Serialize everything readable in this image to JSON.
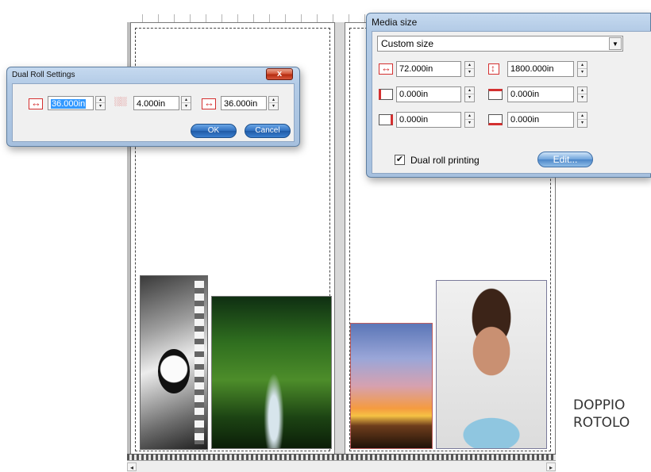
{
  "dual_roll_dialog": {
    "title": "Dual Roll Settings",
    "close_label": "x",
    "left_width": "36.000in",
    "gap": "4.000in",
    "right_width": "36.000in",
    "ok_label": "OK",
    "cancel_label": "Cancel"
  },
  "media_size_dialog": {
    "title": "Media size",
    "size_option": "Custom size",
    "width": "72.000in",
    "height": "1800.000in",
    "margin_left": "0.000in",
    "margin_top": "0.000in",
    "margin_right": "0.000in",
    "margin_bottom": "0.000in",
    "dual_roll_label": "Dual roll printing",
    "dual_roll_checked": "✔",
    "edit_label": "Edit..."
  },
  "caption": {
    "line1": "DOPPIO",
    "line2": "ROTOLO"
  },
  "icons": {
    "spin_up": "▴",
    "spin_down": "▾",
    "dropdown": "▼",
    "scroll_left": "◂",
    "scroll_right": "▸"
  },
  "colors": {
    "accent_red": "#d43030",
    "selection": "#3399ff",
    "window_frame": "#b3cbe6"
  }
}
